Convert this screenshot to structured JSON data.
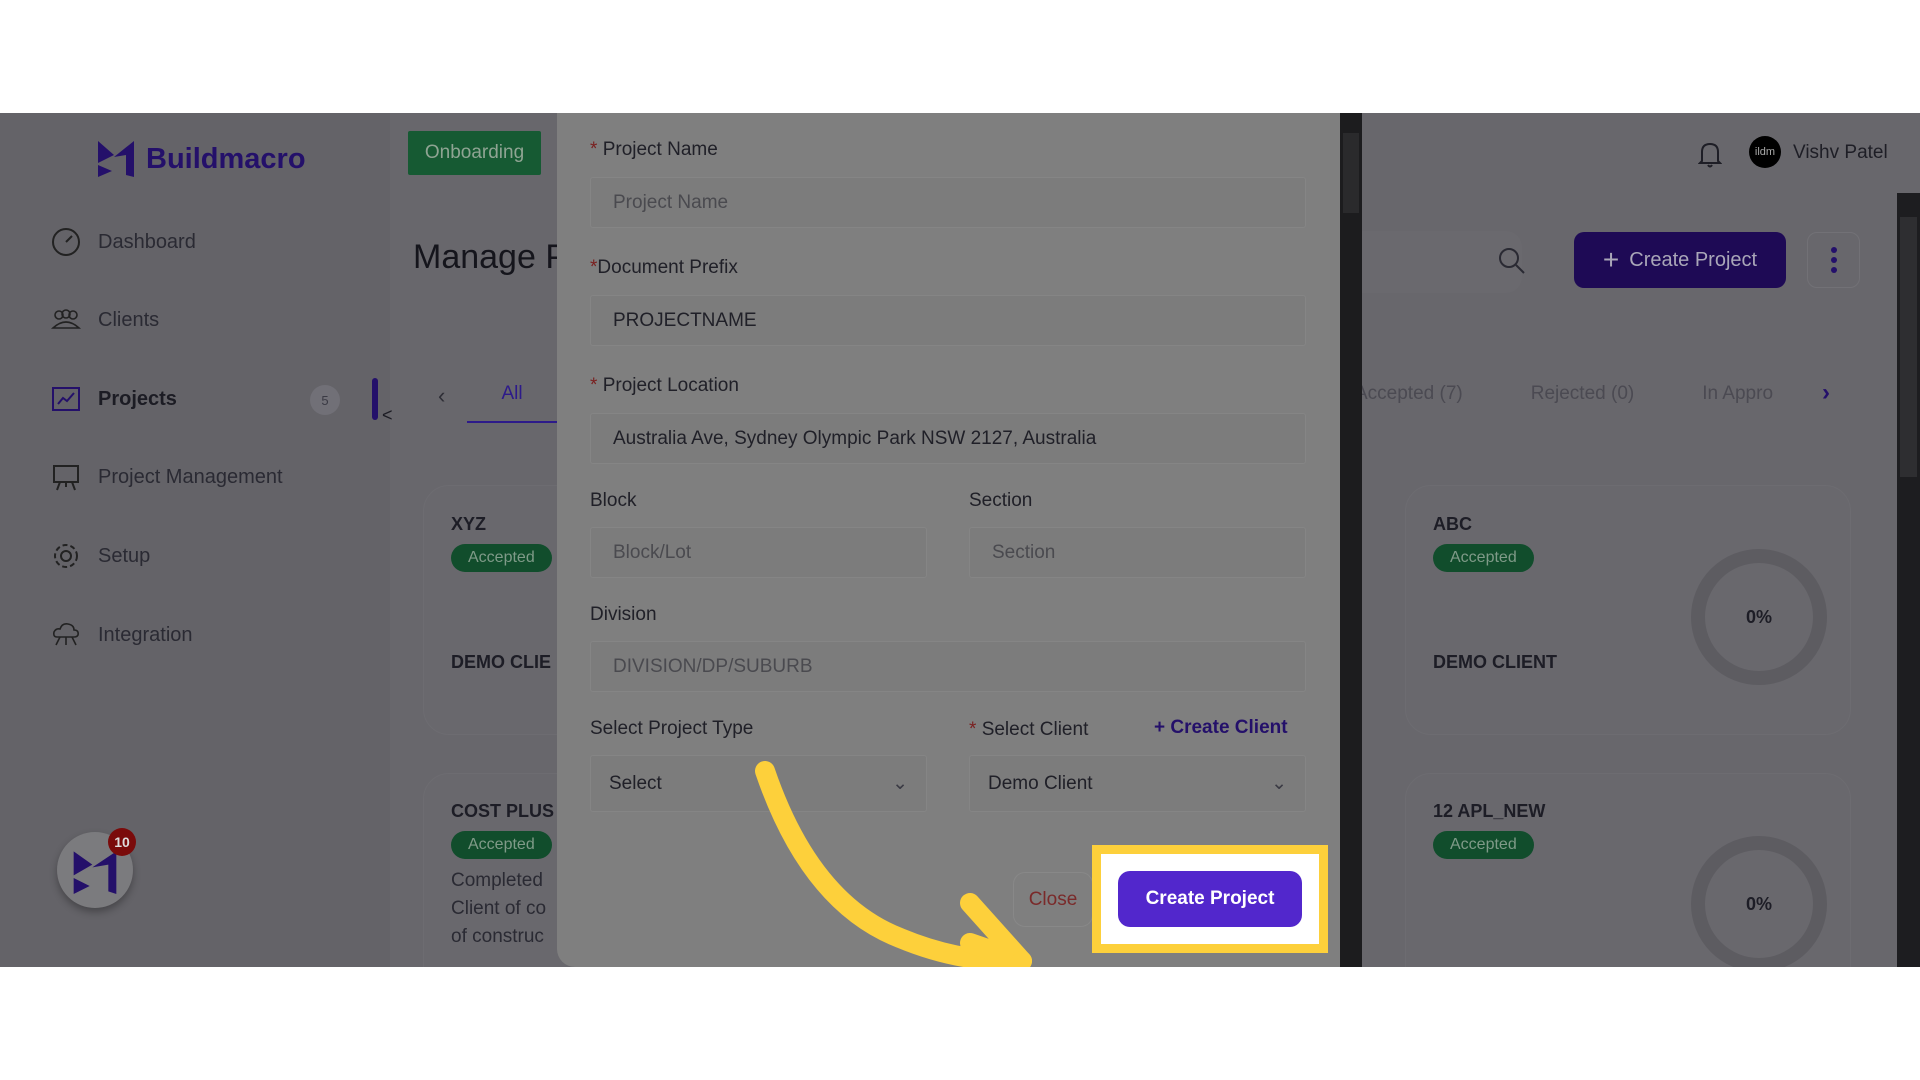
{
  "brand": {
    "name": "Buildmacro",
    "accent": "#5227cc",
    "highlight": "#fdd03b"
  },
  "header": {
    "onboarding_label": "Onboarding",
    "user_name": "Vishv Patel",
    "avatar_text": "ildm"
  },
  "sidebar": {
    "items": [
      {
        "label": "Dashboard",
        "icon": "speedometer-icon"
      },
      {
        "label": "Clients",
        "icon": "users-icon"
      },
      {
        "label": "Projects",
        "icon": "chart-icon",
        "badge": "5"
      },
      {
        "label": "Project Management",
        "icon": "presentation-icon"
      },
      {
        "label": "Setup",
        "icon": "gear-icon"
      },
      {
        "label": "Integration",
        "icon": "cloud-network-icon"
      }
    ],
    "fab_badge": "10"
  },
  "main": {
    "title": "Manage P",
    "create_project_label": "Create Project",
    "tabs": [
      "All",
      "Accepted (7)",
      "Rejected (0)",
      "In Appro"
    ],
    "cards": [
      {
        "name": "XYZ",
        "status": "Accepted",
        "client": "DEMO CLIE"
      },
      {
        "name": "COST PLUS",
        "status": "Accepted",
        "desc": [
          "Completed",
          "Client of co",
          "of construc"
        ]
      },
      {
        "name": "ABC",
        "status": "Accepted",
        "client": "DEMO CLIENT",
        "progress": "0%"
      },
      {
        "name": "12 APL_NEW",
        "status": "Accepted",
        "progress": "0%"
      }
    ]
  },
  "modal": {
    "project_name": {
      "label": "Project Name",
      "placeholder": "Project Name"
    },
    "document_prefix": {
      "label": "Document Prefix",
      "value": "PROJECTNAME"
    },
    "project_location": {
      "label": "Project Location",
      "value": "Australia Ave, Sydney Olympic Park NSW 2127, Australia"
    },
    "block": {
      "label": "Block",
      "placeholder": "Block/Lot"
    },
    "section": {
      "label": "Section",
      "placeholder": "Section"
    },
    "division": {
      "label": "Division",
      "placeholder": "DIVISION/DP/SUBURB"
    },
    "project_type": {
      "label": "Select Project Type",
      "value": "Select"
    },
    "client": {
      "label": "Select Client",
      "value": "Demo Client",
      "create_label": "Create Client"
    },
    "close_label": "Close",
    "submit_label": "Create Project"
  }
}
